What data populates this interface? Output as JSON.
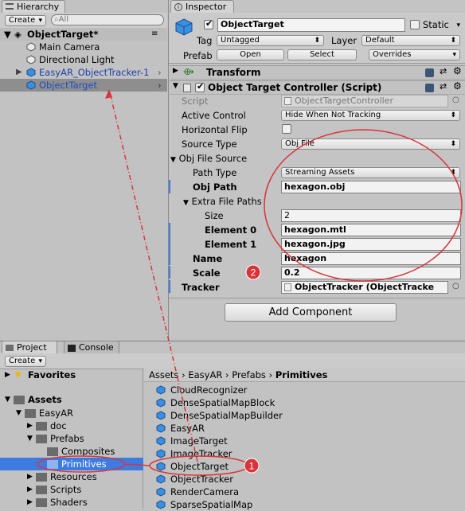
{
  "hierarchy": {
    "tab_label": "Hierarchy",
    "create_label": "Create",
    "search_placeholder": "All",
    "scene_name": "ObjectTarget*",
    "items": [
      "Main Camera",
      "Directional Light",
      "EasyAR_ObjectTracker-1",
      "ObjectTarget"
    ]
  },
  "inspector": {
    "tab_label": "Inspector",
    "object_name": "ObjectTarget",
    "static_label": "Static",
    "tag_label": "Tag",
    "tag_value": "Untagged",
    "layer_label": "Layer",
    "layer_value": "Default",
    "prefab_label": "Prefab",
    "open_label": "Open",
    "select_label": "Select",
    "overrides_label": "Overrides",
    "transform_label": "Transform",
    "component_title": "Object Target Controller (Script)",
    "fields": {
      "script_label": "Script",
      "script_value": "ObjectTargetController",
      "active_control_label": "Active Control",
      "active_control_value": "Hide When Not Tracking",
      "horizontal_flip_label": "Horizontal Flip",
      "source_type_label": "Source Type",
      "source_type_value": "Obj File",
      "obj_file_source_label": "Obj File Source",
      "path_type_label": "Path Type",
      "path_type_value": "Streaming Assets",
      "obj_path_label": "Obj Path",
      "obj_path_value": "hexagon.obj",
      "extra_paths_label": "Extra File Paths",
      "size_label": "Size",
      "size_value": "2",
      "element0_label": "Element 0",
      "element0_value": "hexagon.mtl",
      "element1_label": "Element 1",
      "element1_value": "hexagon.jpg",
      "name_label": "Name",
      "name_value": "hexagon",
      "scale_label": "Scale",
      "scale_value": "0.2",
      "tracker_label": "Tracker",
      "tracker_value": "ObjectTracker (ObjectTracke"
    },
    "add_component_label": "Add Component"
  },
  "project": {
    "tab_label": "Project",
    "console_label": "Console",
    "create_label": "Create",
    "favorites_label": "Favorites",
    "assets_label": "Assets",
    "tree": [
      "EasyAR",
      "doc",
      "Prefabs",
      "Composites",
      "Primitives",
      "Resources",
      "Scripts",
      "Shaders"
    ],
    "breadcrumb": [
      "Assets",
      "EasyAR",
      "Prefabs",
      "Primitives"
    ],
    "assets": [
      "CloudRecognizer",
      "DenseSpatialMapBlock",
      "DenseSpatialMapBuilder",
      "EasyAR",
      "ImageTarget",
      "ImageTracker",
      "ObjectTarget",
      "ObjectTracker",
      "RenderCamera",
      "SparseSpatialMap"
    ]
  },
  "annotations": {
    "marker1": "1",
    "marker2": "2"
  },
  "colors": {
    "highlight": "#3d7be0",
    "annotation_red": "#d9343b",
    "selected_row": "#8e8e8e"
  }
}
